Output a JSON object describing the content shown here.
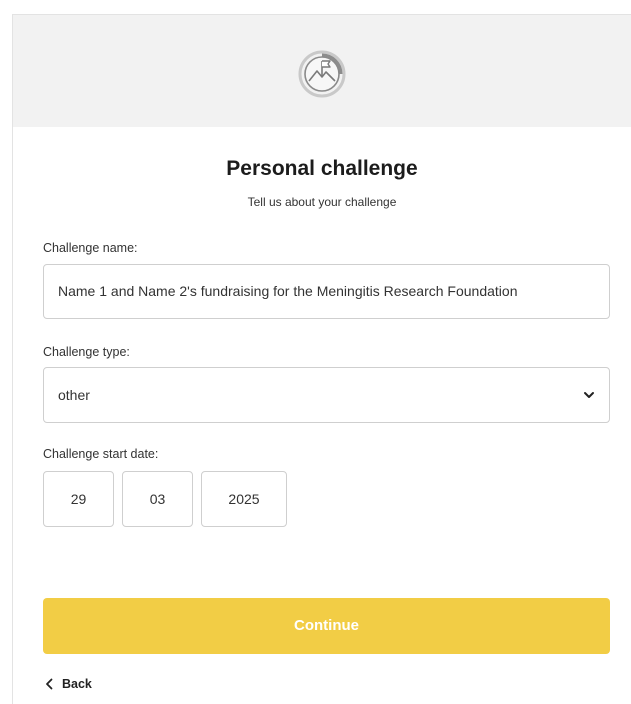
{
  "header": {
    "icon": "mountain-flag-icon"
  },
  "form": {
    "title": "Personal challenge",
    "subtitle": "Tell us about your challenge",
    "challenge_name": {
      "label": "Challenge name:",
      "value": "Name 1 and Name 2's fundraising for the Meningitis Research Foundation"
    },
    "challenge_type": {
      "label": "Challenge type:",
      "value": "other",
      "icon": "chevron-down-icon"
    },
    "start_date": {
      "label": "Challenge start date:",
      "day": "29",
      "month": "03",
      "year": "2025"
    }
  },
  "actions": {
    "continue_label": "Continue",
    "back_label": "Back",
    "back_icon": "chevron-left-icon"
  },
  "colors": {
    "accent": "#f2cd45",
    "header_band": "#f2f2f2",
    "border": "#cfcfcf"
  }
}
